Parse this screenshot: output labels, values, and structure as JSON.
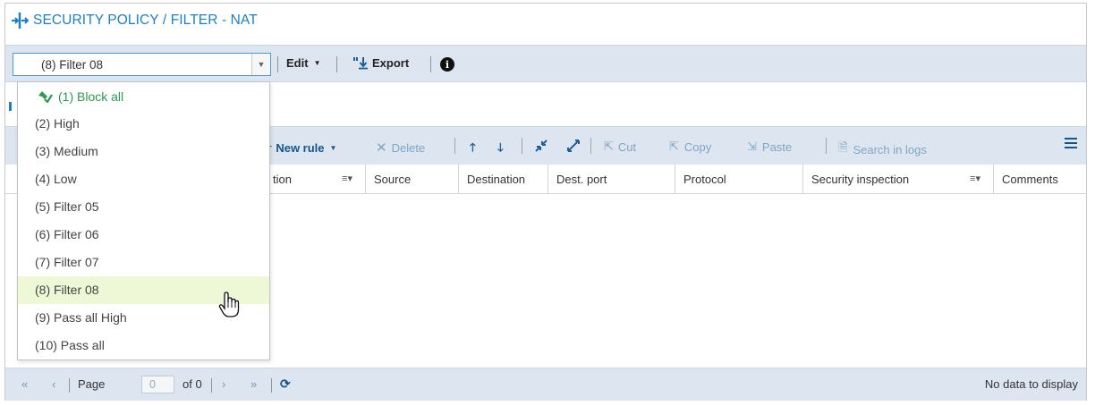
{
  "title": "SECURITY POLICY / FILTER - NAT",
  "toolbar": {
    "selected_policy": "(8) Filter 08",
    "edit_label": "Edit",
    "export_label": "Export",
    "info_glyph": "i"
  },
  "policy_options": [
    {
      "label": "(1) Block all",
      "active": true
    },
    {
      "label": "(2) High"
    },
    {
      "label": "(3) Medium"
    },
    {
      "label": "(4) Low"
    },
    {
      "label": "(5) Filter 05"
    },
    {
      "label": "(6) Filter 06"
    },
    {
      "label": "(7) Filter 07"
    },
    {
      "label": "(8) Filter 08",
      "hovered": true
    },
    {
      "label": "(9) Pass all High"
    },
    {
      "label": "(10) Pass all"
    }
  ],
  "rule_toolbar": {
    "new_rule": "New rule",
    "delete": "Delete",
    "cut": "Cut",
    "copy": "Copy",
    "paste": "Paste",
    "search_in_logs": "Search in logs"
  },
  "columns": {
    "action_partial": "tion",
    "source": "Source",
    "destination": "Destination",
    "dest_port": "Dest. port",
    "protocol": "Protocol",
    "security_inspection": "Security inspection",
    "comments": "Comments"
  },
  "pager": {
    "page_label": "Page",
    "page_value": "0",
    "of_label": "of 0",
    "status": "No data to display"
  },
  "colors": {
    "accent": "#1d7fc4",
    "toolbar_bg": "#dde6f0",
    "active_item": "#2a9a4f",
    "hover_bg": "#eef7d6"
  }
}
